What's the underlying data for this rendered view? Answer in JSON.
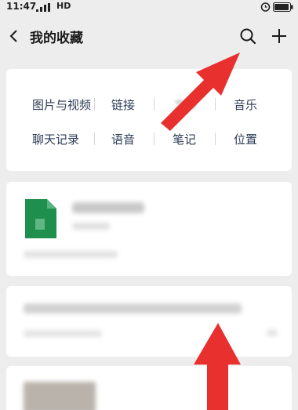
{
  "status_bar": {
    "time": "11:47",
    "network": "HD"
  },
  "nav": {
    "title": "我的收藏"
  },
  "filters": [
    {
      "label": "图片与视频"
    },
    {
      "label": "链接"
    },
    {
      "label": "文件"
    },
    {
      "label": "音乐"
    },
    {
      "label": "聊天记录"
    },
    {
      "label": "语音"
    },
    {
      "label": "笔记"
    },
    {
      "label": "位置"
    }
  ],
  "colors": {
    "arrow": "#e8302f",
    "file_icon": "#1f8f4e",
    "filter_text": "#2d3d56",
    "background": "#ededed"
  },
  "icons": [
    "back-icon",
    "search-icon",
    "add-icon",
    "alarm-icon",
    "battery-icon",
    "signal-icon",
    "spreadsheet-file-icon"
  ]
}
